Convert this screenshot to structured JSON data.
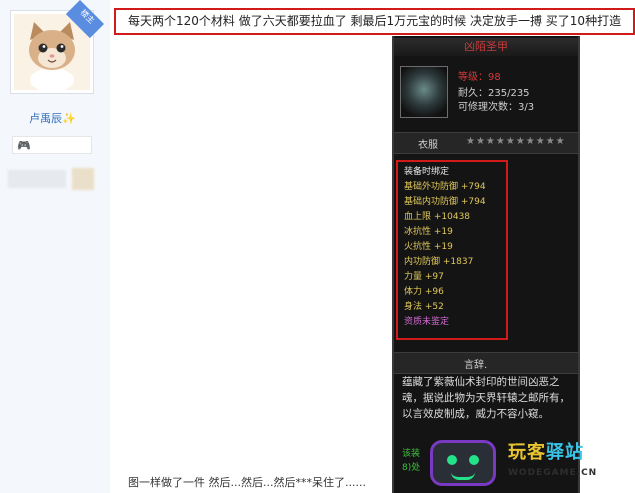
{
  "sidebar": {
    "badge": "楼主",
    "username": "卢禹辰✨",
    "medal": "🎮"
  },
  "post": {
    "title": "每天两个120个材料 做了六天都要拉血了 剩最后1万元宝的时候 决定放手一搏 买了10种打造",
    "bottom_text": "图一样做了一件 然后...然后...然后***呆住了......"
  },
  "item": {
    "name": "凶陌圣甲",
    "level": "等级：98",
    "durability": "耐久：235/235",
    "repair_count": "可修理次数：3/3",
    "section_clothing": "衣服",
    "stars": "★★★★★★★★★★",
    "attributes": [
      {
        "text": "装备时绑定",
        "color": "#e6e6e6"
      },
      {
        "text": "基础外功防御 +794",
        "color": "#e0c85a"
      },
      {
        "text": "基础内功防御 +794",
        "color": "#e0c85a"
      },
      {
        "text": "血上限 +10438",
        "color": "#e0c85a"
      },
      {
        "text": "冰抗性 +19",
        "color": "#e0c85a"
      },
      {
        "text": "火抗性 +19",
        "color": "#e0c85a"
      },
      {
        "text": "内功防御 +1837",
        "color": "#e0c85a"
      },
      {
        "text": "力量 +97",
        "color": "#e0c85a"
      },
      {
        "text": "体力 +96",
        "color": "#e0c85a"
      },
      {
        "text": "身法 +52",
        "color": "#e0c85a"
      },
      {
        "text": "资质未鉴定",
        "color": "#d06ad0"
      }
    ],
    "section_description": "言辞.",
    "description": "蕴藏了紫薇仙术封印的世间凶恶之魂，据说此物为天界轩辕之邮所有，以言效皮制成，威力不容小窥。",
    "green_lines": [
      "该装",
      "8)处"
    ]
  },
  "watermark": {
    "cn_1": "玩客",
    "cn_2": "驿站",
    "url": "WODEGAME.CN"
  }
}
